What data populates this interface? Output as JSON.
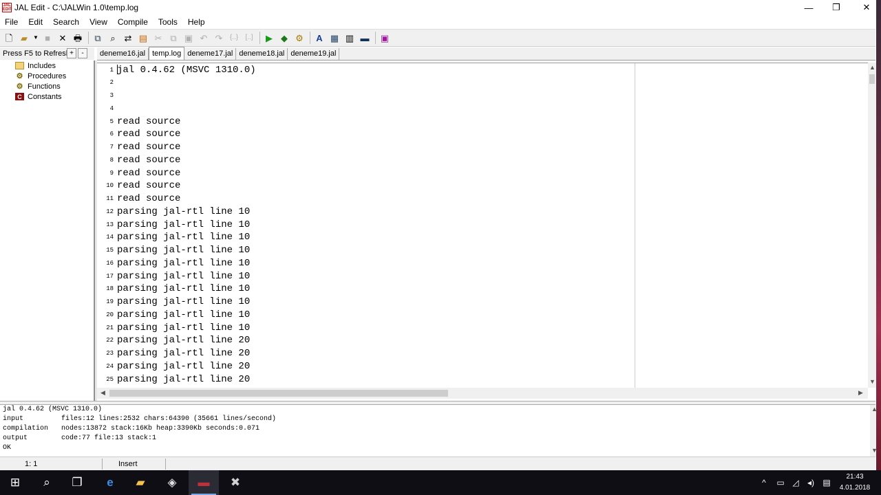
{
  "window": {
    "title": "JAL Edit - C:\\JALWin 1.0\\temp.log",
    "app_icon_text": "JAL EDIT",
    "minimize": "—",
    "restore": "❐",
    "close": "✕"
  },
  "menu": [
    "File",
    "Edit",
    "Search",
    "View",
    "Compile",
    "Tools",
    "Help"
  ],
  "left_panel": {
    "refresh_label": "Press F5 to Refresh",
    "expand": "+",
    "collapse": "-",
    "tree": [
      {
        "label": "Includes",
        "icon": "folder-icon"
      },
      {
        "label": "Procedures",
        "icon": "gears-icon"
      },
      {
        "label": "Functions",
        "icon": "gears-icon"
      },
      {
        "label": "Constants",
        "icon": "constant-icon"
      }
    ]
  },
  "tabs": [
    {
      "label": "deneme16.jal",
      "active": false
    },
    {
      "label": "temp.log",
      "active": true
    },
    {
      "label": "deneme17.jal",
      "active": false
    },
    {
      "label": "deneme18.jal",
      "active": false
    },
    {
      "label": "deneme19.jal",
      "active": false
    }
  ],
  "editor": {
    "lines": [
      {
        "n": "1",
        "text": "jal 0.4.62 (MSVC 1310.0)"
      },
      {
        "n": "2",
        "text": ""
      },
      {
        "n": "3",
        "text": ""
      },
      {
        "n": "4",
        "text": ""
      },
      {
        "n": "5",
        "text": "read source"
      },
      {
        "n": "6",
        "text": "read source"
      },
      {
        "n": "7",
        "text": "read source"
      },
      {
        "n": "8",
        "text": "read source"
      },
      {
        "n": "9",
        "text": "read source"
      },
      {
        "n": "10",
        "text": "read source"
      },
      {
        "n": "11",
        "text": "read source"
      },
      {
        "n": "12",
        "text": "parsing jal-rtl line 10"
      },
      {
        "n": "13",
        "text": "parsing jal-rtl line 10"
      },
      {
        "n": "14",
        "text": "parsing jal-rtl line 10"
      },
      {
        "n": "15",
        "text": "parsing jal-rtl line 10"
      },
      {
        "n": "16",
        "text": "parsing jal-rtl line 10"
      },
      {
        "n": "17",
        "text": "parsing jal-rtl line 10"
      },
      {
        "n": "18",
        "text": "parsing jal-rtl line 10"
      },
      {
        "n": "19",
        "text": "parsing jal-rtl line 10"
      },
      {
        "n": "20",
        "text": "parsing jal-rtl line 10"
      },
      {
        "n": "21",
        "text": "parsing jal-rtl line 10"
      },
      {
        "n": "22",
        "text": "parsing jal-rtl line 20"
      },
      {
        "n": "23",
        "text": "parsing jal-rtl line 20"
      },
      {
        "n": "24",
        "text": "parsing jal-rtl line 20"
      },
      {
        "n": "25",
        "text": "parsing jal-rtl line 20"
      }
    ]
  },
  "output": {
    "header": "jal 0.4.62 (MSVC 1310.0)",
    "rows": [
      {
        "key": "input",
        "value": "files:12 lines:2532 chars:64390 (35661 lines/second)"
      },
      {
        "key": "compilation",
        "value": "nodes:13872 stack:16Kb heap:3390Kb seconds:0.071"
      },
      {
        "key": "output",
        "value": "code:77 file:13 stack:1"
      }
    ],
    "result": "OK"
  },
  "status": {
    "position": "1:  1",
    "mode": "Insert"
  },
  "taskbar": {
    "clock_time": "21:43",
    "clock_date": "4.01.2018",
    "tray_up": "^"
  }
}
